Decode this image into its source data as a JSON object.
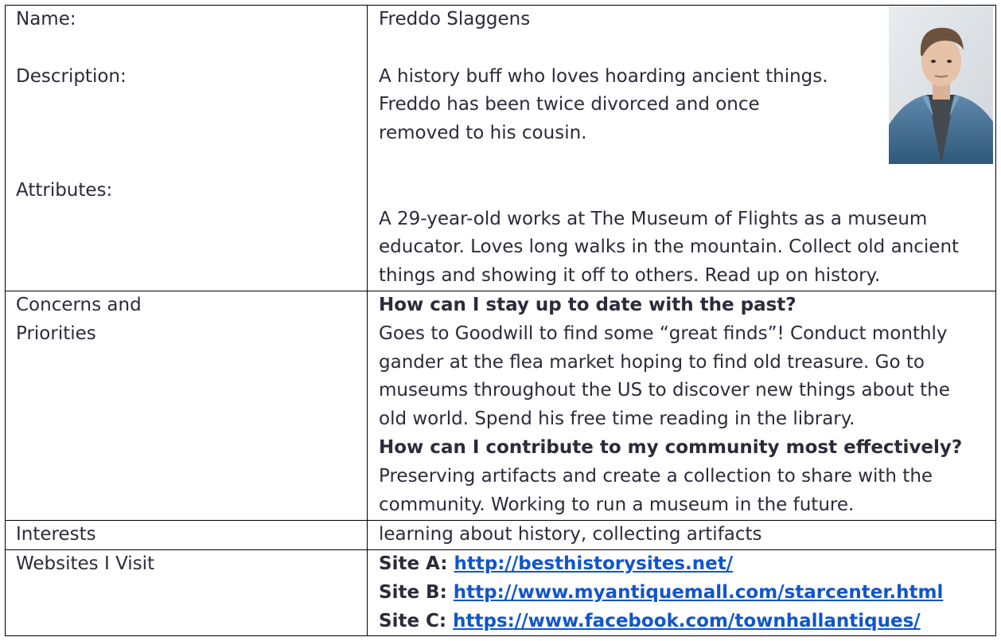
{
  "persona": {
    "labels": {
      "name": "Name:",
      "description": "Description:",
      "attributes": "Attributes:",
      "concerns_line1": "Concerns and",
      "concerns_line2": "Priorities",
      "interests": "Interests",
      "websites": "Websites I Visit"
    },
    "name": "Freddo Slaggens",
    "photo_icon": "portrait-photo",
    "description_lines": [
      "A history buff who loves hoarding ancient things.",
      "Freddo has been twice divorced and once",
      "removed to his cousin."
    ],
    "attributes_lines": [
      "A 29-year-old works at The Museum of Flights as a museum",
      "educator. Loves long walks in the mountain. Collect old ancient",
      "things and showing it off to others. Read up on history."
    ],
    "concerns": {
      "q1": "How can I stay up to date with the past?",
      "a1_lines": [
        "Goes to Goodwill to find some “great finds”!  Conduct monthly",
        "gander at the flea market hoping to find old treasure. Go to",
        "museums throughout the US to discover new things about the",
        "old world. Spend his free time reading in the library."
      ],
      "q2": "How can I contribute to my community most effectively?",
      "a2_lines": [
        "Preserving artifacts and create a collection to share with the",
        "community. Working to run a museum in the future."
      ]
    },
    "interests": "learning about history, collecting artifacts",
    "websites": [
      {
        "prefix": "Site A: ",
        "url": "http://besthistorysites.net/"
      },
      {
        "prefix": "Site B: ",
        "url": "http://www.myantiquemall.com/starcenter.html"
      },
      {
        "prefix": "Site C: ",
        "url": "https://www.facebook.com/townhallantiques/"
      }
    ],
    "colors": {
      "text": "#2b2b3a",
      "link": "#1155cc",
      "border": "#000000"
    }
  }
}
